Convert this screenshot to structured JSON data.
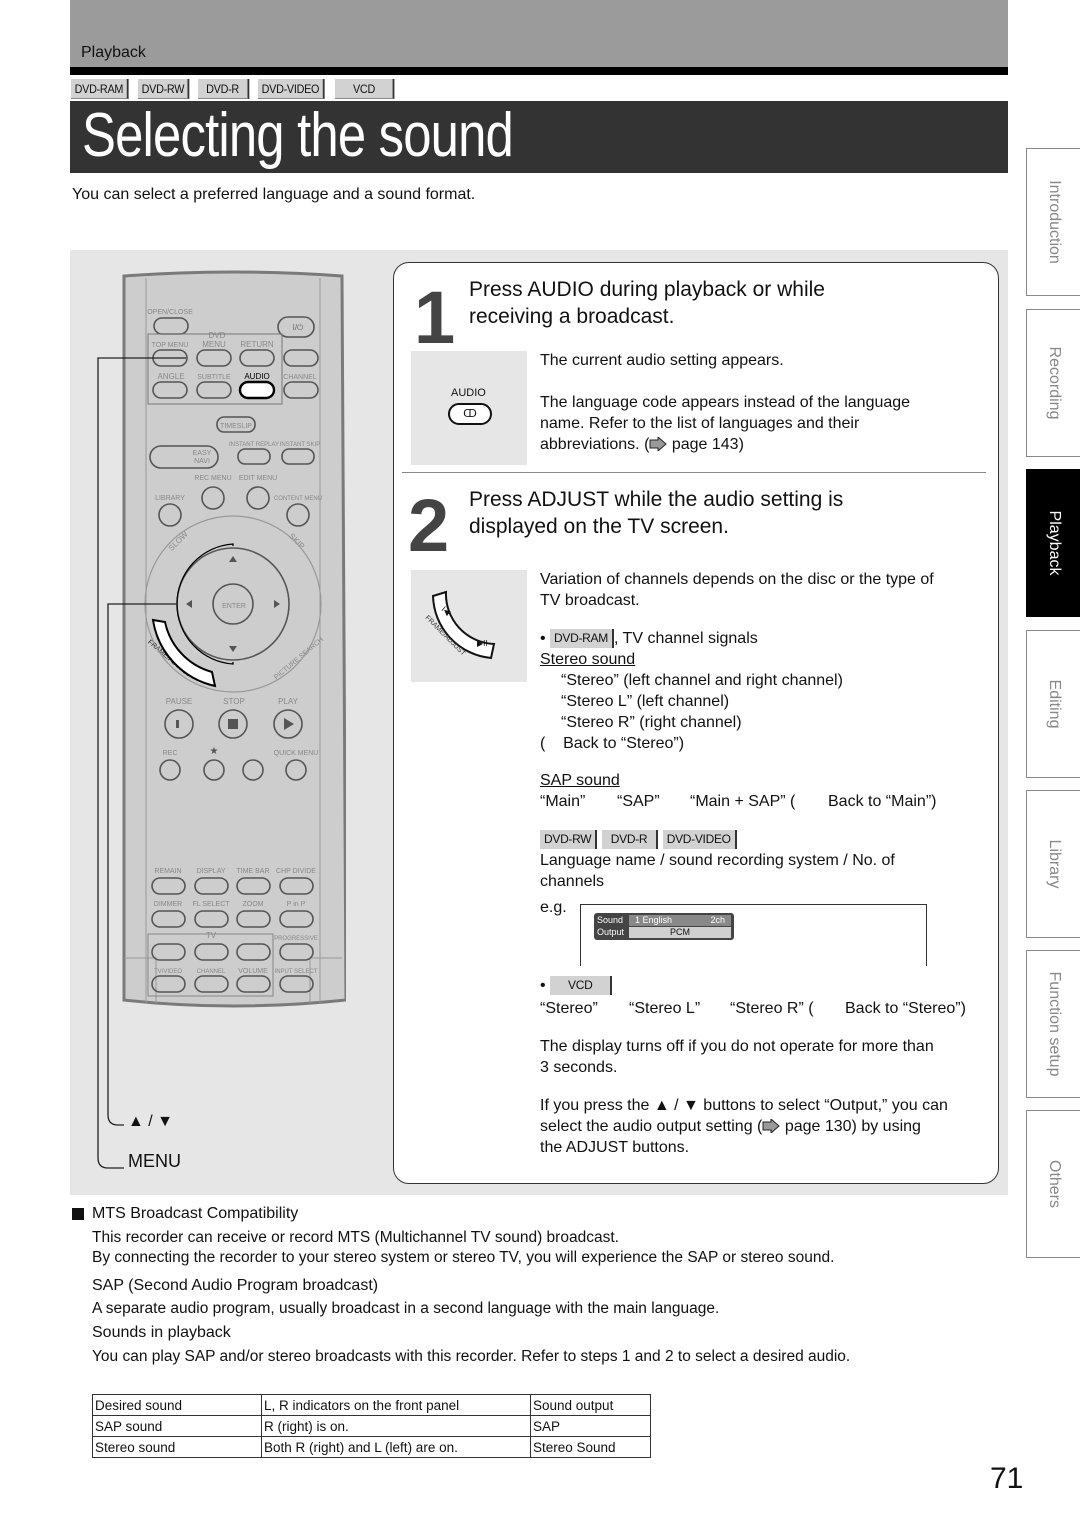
{
  "header": {
    "section": "Playback",
    "disc_tags": [
      "DVD-RAM",
      "DVD-RW",
      "DVD-R",
      "DVD-VIDEO",
      "VCD"
    ],
    "title": "Selecting the sound",
    "intro": "You can select a preferred language and a sound format."
  },
  "remote": {
    "labels": {
      "open_close": "OPEN/CLOSE",
      "power": "I/⏻",
      "dvd": "DVD",
      "top_menu": "TOP MENU",
      "menu": "MENU",
      "return": "RETURN",
      "angle": "ANGLE",
      "subtitle": "SUBTITLE",
      "audio": "AUDIO",
      "channel": "CHANNEL",
      "timeslip": "TIMESLIP",
      "instant_replay": "INSTANT REPLAY",
      "instant_skip": "INSTANT SKIP",
      "easy_navi_1": "EASY",
      "easy_navi_2": "NAVI",
      "rec_menu": "REC MENU",
      "edit_menu": "EDIT MENU",
      "library": "LIBRARY",
      "content_menu": "CONTENT MENU",
      "slow": "SLOW",
      "skip": "SKIP",
      "enter": "ENTER",
      "frame_adjust": "FRAME/ADJUST",
      "picture_search": "PICTURE SEARCH",
      "pause": "PAUSE",
      "stop": "STOP",
      "play": "PLAY",
      "rec": "REC",
      "quick_menu": "QUICK MENU",
      "remain": "REMAIN",
      "display": "DISPLAY",
      "time_bar": "TIME BAR",
      "chp_divide": "CHP DIVIDE",
      "dimmer": "DIMMER",
      "fl_select": "FL SELECT",
      "zoom": "ZOOM",
      "p_in_p": "P in P",
      "tv": "TV",
      "progressive": "PROGRESSIVE",
      "tv_video": "TV/VIDEO",
      "tv_channel": "CHANNEL",
      "volume": "VOLUME",
      "input_select": "INPUT SELECT"
    },
    "callouts": {
      "up_down": "▲ / ▼",
      "menu": "MENU"
    }
  },
  "step1": {
    "number": "1",
    "heading_line1": "Press AUDIO during playback or while",
    "heading_line2": "receiving a broadcast.",
    "thumb_label": "AUDIO",
    "p1": "The current audio setting appears.",
    "p2_line1": "The language code appears instead of the language",
    "p2_line2": "name. Refer to the list of languages and their",
    "p2_line3_a": "abbreviations. (",
    "p2_line3_b": " page 143)"
  },
  "step2": {
    "number": "2",
    "heading_line1": "Press ADJUST while the audio setting is",
    "heading_line2": "displayed on the TV screen.",
    "thumb_label": "FRAME/ADJUST",
    "variation_line1": "Variation of channels depends on the disc or the type of",
    "variation_line2": "TV broadcast.",
    "ram_tag": "DVD-RAM",
    "ram_text": ", TV channel signals",
    "stereo_heading": "Stereo sound",
    "stereo_items": [
      "“Stereo” (left channel and right channel)",
      "“Stereo L” (left channel)",
      "“Stereo R” (right channel)"
    ],
    "stereo_back": "(    Back to “Stereo”)",
    "sap_heading": "SAP sound",
    "sap_sequence": [
      "“Main”",
      "“SAP”",
      "“Main + SAP” (",
      "Back to “Main”)"
    ],
    "dvd_tags": [
      "DVD-RW",
      "DVD-R",
      "DVD-VIDEO"
    ],
    "dvd_desc_line1": "Language name / sound recording system / No. of",
    "dvd_desc_line2": "channels",
    "eg_label": "e.g.",
    "osd": {
      "row1_label": "Sound",
      "row1_value_a": "1  English",
      "row1_value_b": "2ch",
      "row2_label": "Output",
      "row2_value": "PCM"
    },
    "vcd_tag": "VCD",
    "vcd_sequence": [
      "“Stereo”",
      "“Stereo L”",
      "“Stereo R” (",
      "Back to “Stereo”)"
    ],
    "display_off_line1": "The display turns off if you do not operate for more than",
    "display_off_line2": "3 seconds.",
    "output_line1": "If you press the ▲ / ▼ buttons to select “Output,” you can",
    "output_line2_a": "select the audio output setting (",
    "output_line2_b": " page 130) by using",
    "output_line3": "the ADJUST buttons."
  },
  "side_tabs": [
    {
      "label": "Introduction",
      "active": false
    },
    {
      "label": "Recording",
      "active": false
    },
    {
      "label": "Playback",
      "active": true
    },
    {
      "label": "Editing",
      "active": false
    },
    {
      "label": "Library",
      "active": false
    },
    {
      "label": "Function setup",
      "active": false
    },
    {
      "label": "Others",
      "active": false
    }
  ],
  "notes": {
    "mts_heading": "MTS Broadcast Compatibility",
    "mts_line1": "This recorder can receive or record MTS (Multichannel TV sound) broadcast.",
    "mts_line2": "By connecting the recorder to your stereo system or stereo TV, you will experience the SAP or stereo sound.",
    "sap_heading": "SAP (Second Audio Program broadcast)",
    "sap_body": "A separate audio program, usually broadcast in a second language with the main language.",
    "playback_heading": "Sounds in playback",
    "playback_body": "You can play SAP and/or stereo broadcasts with this recorder. Refer to steps 1 and 2 to select a desired audio."
  },
  "table": {
    "headers": [
      "Desired sound",
      "L, R indicators on the front panel",
      "Sound output"
    ],
    "rows": [
      [
        "SAP sound",
        "R (right) is on.",
        "SAP"
      ],
      [
        "Stereo sound",
        "Both R (right) and L (left) are on.",
        "Stereo Sound"
      ]
    ]
  },
  "page_number": "71"
}
